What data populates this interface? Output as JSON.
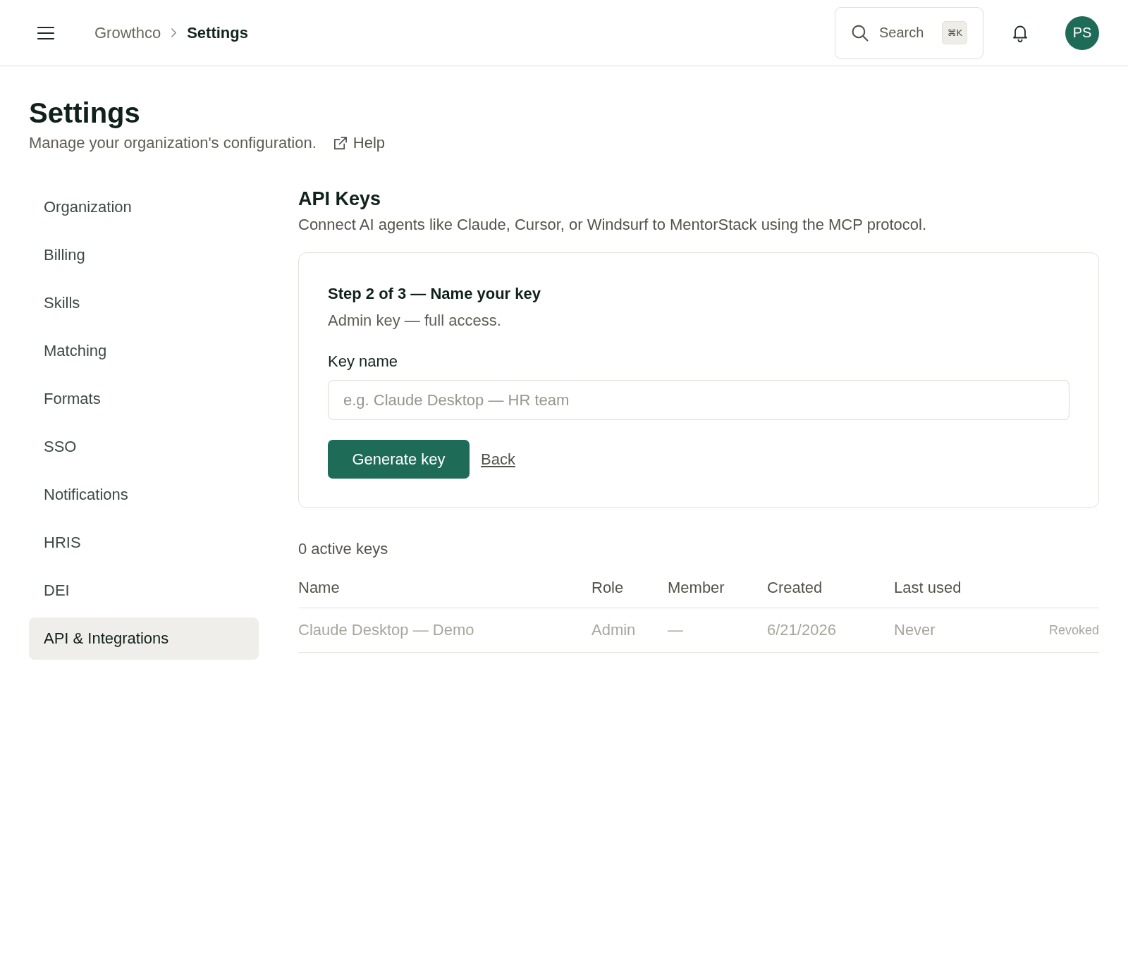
{
  "topbar": {
    "breadcrumb": [
      {
        "label": "Growthco",
        "current": false
      },
      {
        "label": "Settings",
        "current": true
      }
    ],
    "search": {
      "label": "Search",
      "shortcut": "⌘K"
    },
    "avatar": {
      "initials": "PS"
    }
  },
  "page": {
    "title": "Settings",
    "subtitle": "Manage your organization's configuration.",
    "help_link": "Help"
  },
  "sidebar": {
    "items": [
      {
        "label": "Organization",
        "selected": false
      },
      {
        "label": "Billing",
        "selected": false
      },
      {
        "label": "Skills",
        "selected": false
      },
      {
        "label": "Matching",
        "selected": false
      },
      {
        "label": "Formats",
        "selected": false
      },
      {
        "label": "SSO",
        "selected": false
      },
      {
        "label": "Notifications",
        "selected": false
      },
      {
        "label": "HRIS",
        "selected": false
      },
      {
        "label": "DEI",
        "selected": false
      },
      {
        "label": "API & Integrations",
        "selected": true
      }
    ]
  },
  "section": {
    "title": "API Keys",
    "description": "Connect AI agents like Claude, Cursor, or Windsurf to MentorStack using the MCP protocol."
  },
  "wizard": {
    "step": "Step 2 of 3 — Name your key",
    "note": "Admin key — full access.",
    "field": {
      "label": "Key name",
      "placeholder": "e.g. Claude Desktop — HR team"
    },
    "primary_button": "Generate key",
    "back_link": "Back"
  },
  "keys": {
    "summary": "0 active keys",
    "columns": [
      "Name",
      "Role",
      "Member",
      "Created",
      "Last used"
    ],
    "rows": [
      {
        "name": "Claude Desktop — Demo",
        "role": "Admin",
        "member": "—",
        "created": "6/21/2026",
        "last_used": "Never",
        "status": "Revoked",
        "revoked": true
      }
    ]
  }
}
